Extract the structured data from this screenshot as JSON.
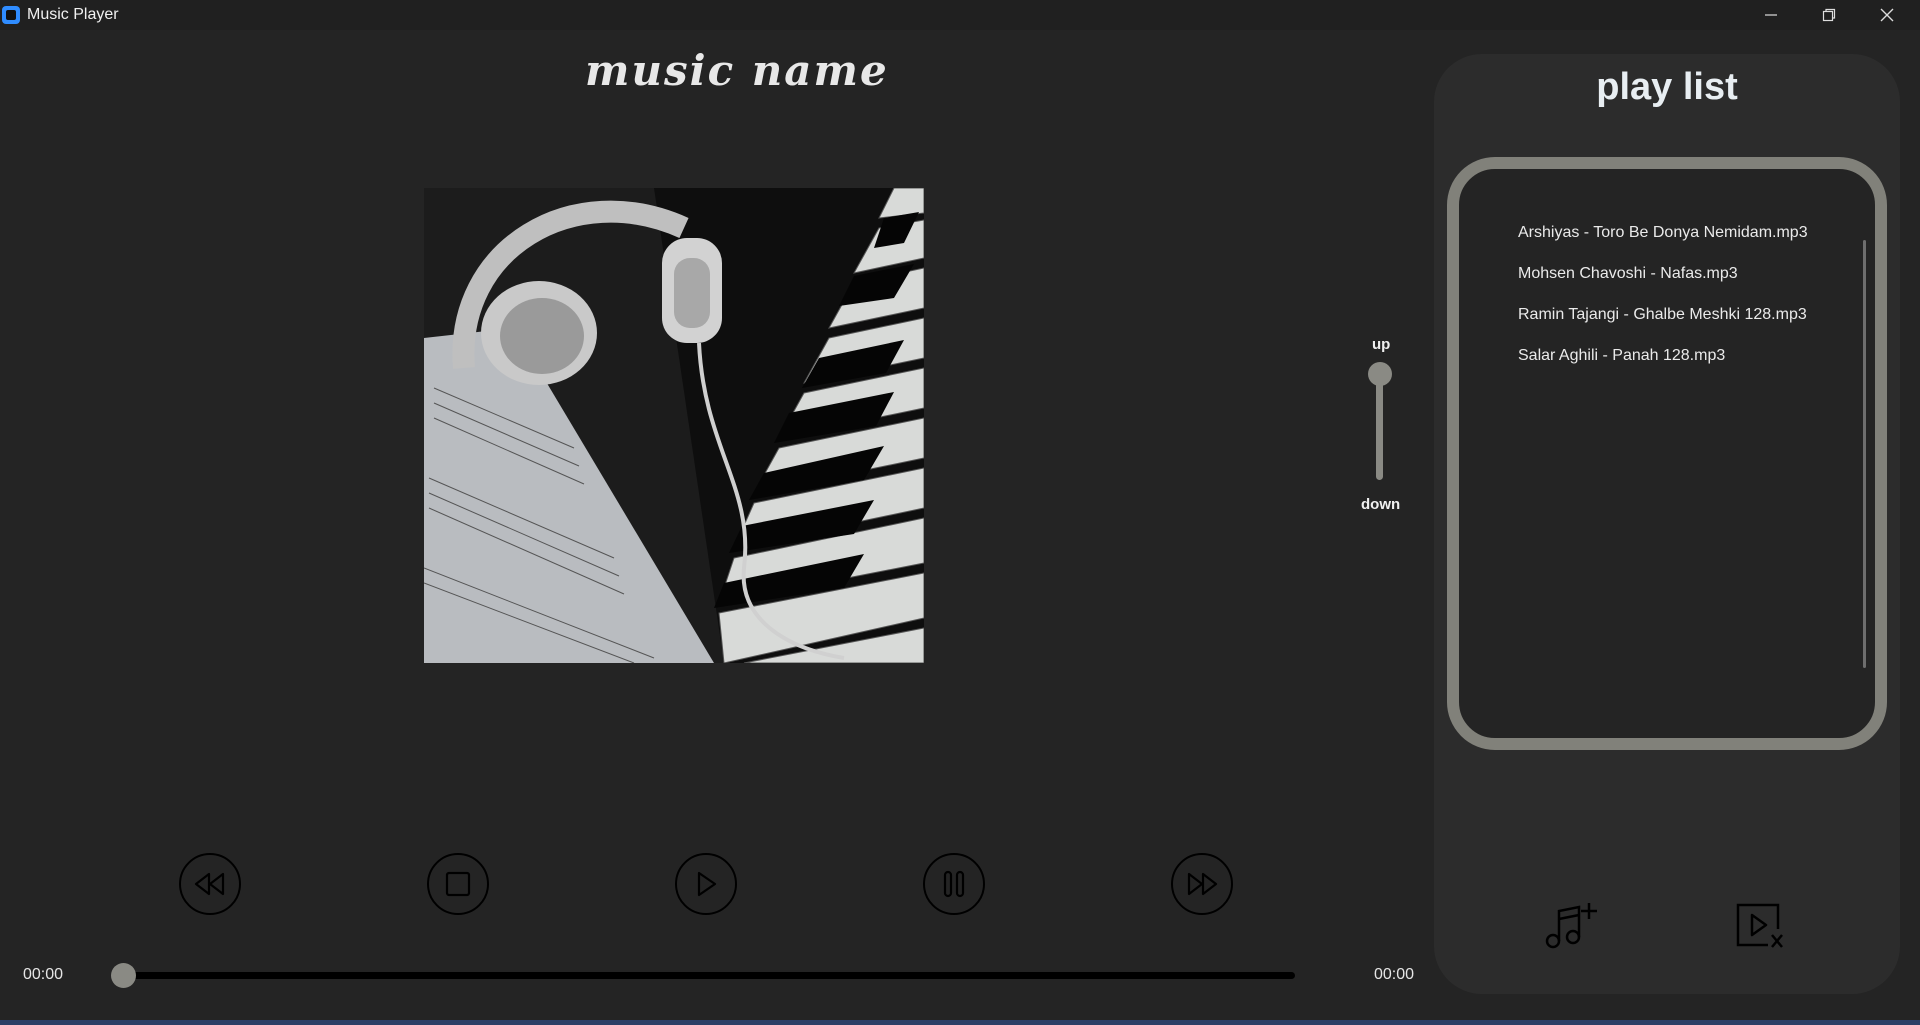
{
  "window": {
    "title": "Music Player",
    "controls": [
      "minimize-icon",
      "restore-icon",
      "close-icon"
    ]
  },
  "player": {
    "song_title": "music name",
    "cover_alt": "headphones on piano keys with sheet music",
    "volume": {
      "up_label": "up",
      "down_label": "down",
      "level": 1.0
    },
    "controls": [
      {
        "name": "rewind",
        "icon": "rewind-icon"
      },
      {
        "name": "stop",
        "icon": "stop-icon"
      },
      {
        "name": "play",
        "icon": "play-icon"
      },
      {
        "name": "pause",
        "icon": "pause-icon"
      },
      {
        "name": "fast-forward",
        "icon": "fast-forward-icon"
      }
    ],
    "progress": {
      "current_time": "00:00",
      "total_time": "00:00",
      "fraction": 0
    }
  },
  "playlist": {
    "title": "play list",
    "items": [
      "Arshiyas - Toro Be Donya Nemidam.mp3",
      "Mohsen Chavoshi - Nafas.mp3",
      "Ramin Tajangi - Ghalbe Meshki 128.mp3",
      "Salar Aghili - Panah 128.mp3"
    ],
    "buttons": [
      {
        "name": "add-music",
        "icon": "add-music-icon"
      },
      {
        "name": "remove-music",
        "icon": "remove-playlist-icon"
      }
    ]
  },
  "colors": {
    "background": "#242424",
    "panel": "#2c2c2c",
    "accent_grey": "#81817a",
    "titlebar": "#202020",
    "app_icon": "#2f8cff"
  }
}
